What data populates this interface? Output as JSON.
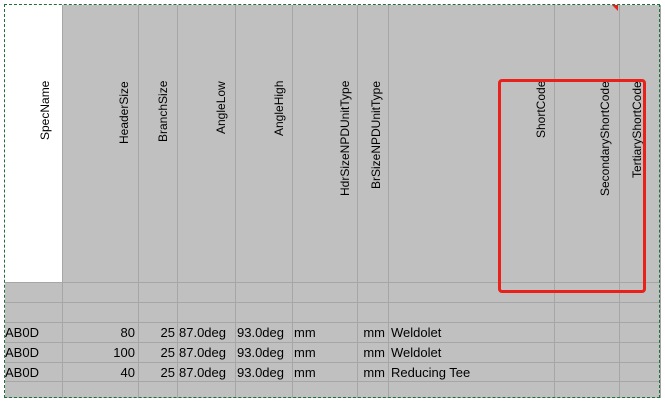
{
  "headers": [
    "SpecName",
    "HeaderSize",
    "BranchSize",
    "AngleLow",
    "AngleHigh",
    "HdrSizeNPDUnitType",
    "BrSizeNPDUnitType",
    "",
    "ShortCode",
    "SecondaryShortCode",
    "TertiaryShortCode"
  ],
  "rows": [
    [
      "AB0D",
      "80",
      "25",
      "87.0deg",
      "93.0deg",
      "mm",
      "mm",
      "Weldolet"
    ],
    [
      "AB0D",
      "100",
      "25",
      "87.0deg",
      "93.0deg",
      "mm",
      "mm",
      "Weldolet"
    ],
    [
      "AB0D",
      "40",
      "25",
      "87.0deg",
      "93.0deg",
      "mm",
      "mm",
      "Reducing Tee"
    ]
  ],
  "colors": {
    "cell_fill": "#c0c0c0",
    "grid": "#a6a6a6",
    "highlight": "#e8211b",
    "selection": "#1f6f3a"
  }
}
